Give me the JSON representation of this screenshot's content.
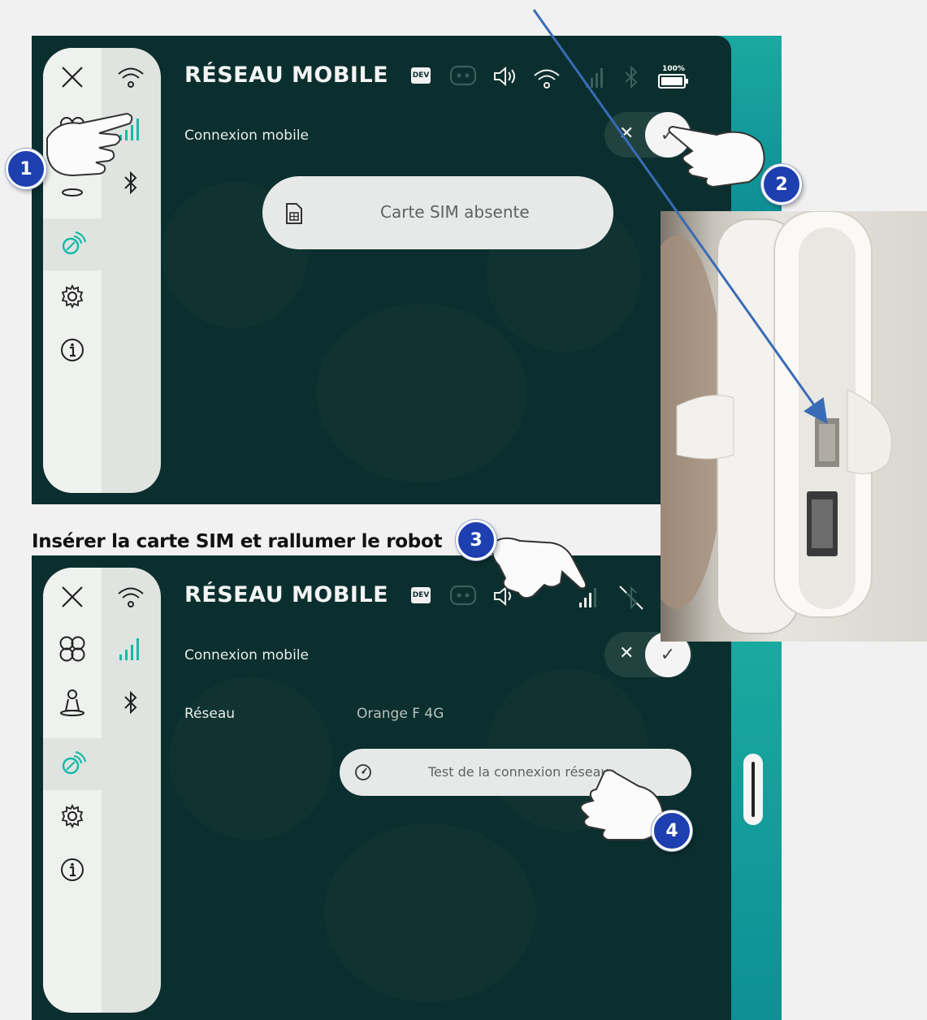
{
  "panel_top": {
    "title": "RÉSEAU MOBILE",
    "dev_badge": "DEV",
    "battery_label": "100%",
    "mobile_row_label": "Connexion mobile",
    "sim_status": "Carte SIM absente"
  },
  "instruction": "Insérer la carte SIM et rallumer le robot",
  "panel_bottom": {
    "title": "RÉSEAU MOBILE",
    "dev_badge": "DEV",
    "mobile_row_label": "Connexion mobile",
    "network_label": "Réseau",
    "network_value": "Orange F 4G",
    "test_button": "Test de la connexion réseau"
  },
  "steps": [
    "1",
    "2",
    "3",
    "4"
  ],
  "colors": {
    "panel_bg": "#0b2f2e",
    "accent": "#1aa9a0",
    "badge": "#1d3fb0",
    "signal_active": "#17b9a6"
  },
  "icons": [
    "close-icon",
    "wifi-icon",
    "signal-icon",
    "bluetooth-icon",
    "settings-icon",
    "info-icon",
    "robot-icon",
    "volume-icon",
    "battery-icon",
    "sim-card-icon",
    "speedometer-icon",
    "network-settings-icon"
  ]
}
